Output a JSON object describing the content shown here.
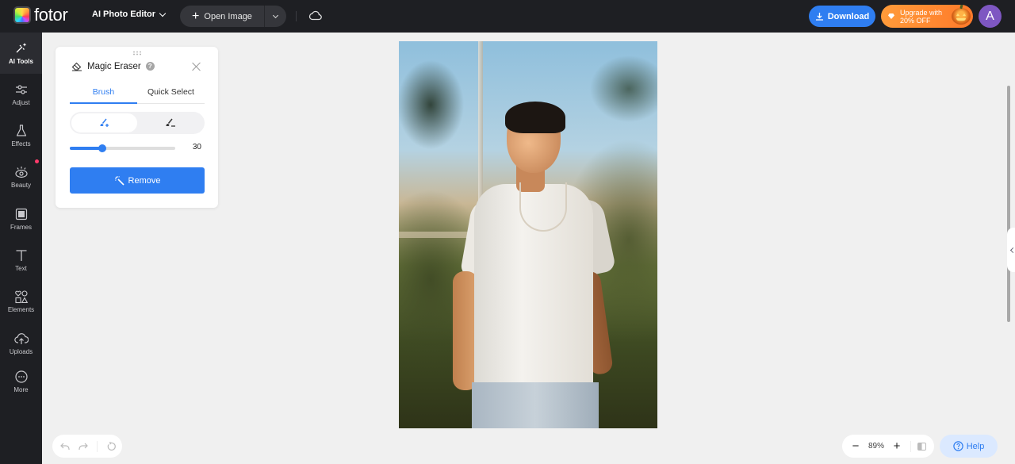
{
  "app": {
    "brand": "fotor"
  },
  "topbar": {
    "product_menu": "AI Photo Editor",
    "open_image": "Open Image",
    "download": "Download",
    "upgrade_line1": "Upgrade with",
    "upgrade_line2": "20% OFF",
    "avatar_initial": "A",
    "colors": {
      "download": "#2f7ef1",
      "upgrade": "#ff8a33",
      "avatar": "#7e57c2"
    }
  },
  "sidebar": {
    "items": [
      {
        "label": "AI Tools",
        "icon": "sparkle-icon",
        "active": true
      },
      {
        "label": "Adjust",
        "icon": "sliders-icon"
      },
      {
        "label": "Effects",
        "icon": "flask-icon"
      },
      {
        "label": "Beauty",
        "icon": "eye-icon",
        "badge": true
      },
      {
        "label": "Frames",
        "icon": "frame-icon"
      },
      {
        "label": "Text",
        "icon": "text-icon"
      },
      {
        "label": "Elements",
        "icon": "shapes-icon"
      },
      {
        "label": "Uploads",
        "icon": "cloud-upload-icon"
      },
      {
        "label": "More",
        "icon": "more-icon"
      }
    ]
  },
  "panel": {
    "title": "Magic Eraser",
    "help": "?",
    "tabs": [
      {
        "label": "Brush",
        "active": true
      },
      {
        "label": "Quick Select"
      }
    ],
    "modes": [
      {
        "name": "brush-add",
        "active": true
      },
      {
        "name": "brush-erase"
      }
    ],
    "brush_size": {
      "value": 30,
      "fraction": 0.31
    },
    "remove_button": "Remove"
  },
  "bottom": {
    "zoom_level": "89%",
    "help": "Help"
  }
}
